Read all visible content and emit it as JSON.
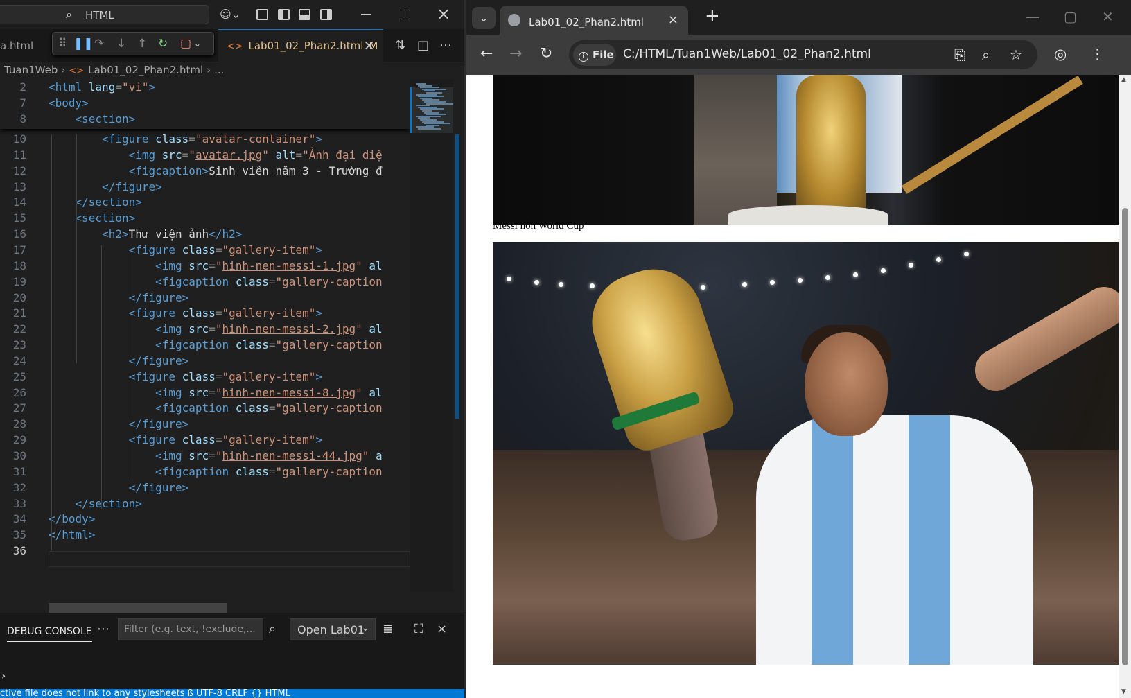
{
  "vscode": {
    "command_center": "HTML",
    "tab_prev": "a.html",
    "tab_active": {
      "label": "Lab01_02_Phan2.html",
      "modified": "M"
    },
    "breadcrumb": [
      "Tuan1Web",
      "Lab01_02_Phan2.html",
      "..."
    ],
    "sticky_lines": [
      {
        "n": "2",
        "code": [
          [
            "tg",
            "<html"
          ],
          [
            "at",
            " lang"
          ],
          [
            "pu",
            "="
          ],
          [
            "st",
            "\"vi\""
          ],
          [
            "tg",
            ">"
          ]
        ]
      },
      {
        "n": "7",
        "code": [
          [
            "tg",
            "<body>"
          ]
        ]
      },
      {
        "n": "8",
        "code": [
          [
            "tx",
            "    "
          ],
          [
            "tg",
            "<section>"
          ]
        ]
      }
    ],
    "lines": [
      {
        "n": "10",
        "code": [
          [
            "tx",
            "        "
          ],
          [
            "tg",
            "<figure"
          ],
          [
            "at",
            " class"
          ],
          [
            "pu",
            "="
          ],
          [
            "st",
            "\"avatar-container\""
          ],
          [
            "tg",
            ">"
          ]
        ]
      },
      {
        "n": "11",
        "code": [
          [
            "tx",
            "            "
          ],
          [
            "tg",
            "<img"
          ],
          [
            "at",
            " src"
          ],
          [
            "pu",
            "="
          ],
          [
            "st",
            "\""
          ],
          [
            "stu",
            "avatar.jpg"
          ],
          [
            "st",
            "\""
          ],
          [
            "at",
            " alt"
          ],
          [
            "pu",
            "="
          ],
          [
            "st",
            "\"Ảnh đại diệ"
          ]
        ]
      },
      {
        "n": "12",
        "code": [
          [
            "tx",
            "            "
          ],
          [
            "tg",
            "<figcaption>"
          ],
          [
            "tx",
            "Sinh viên năm 3 - Trường đ"
          ]
        ]
      },
      {
        "n": "13",
        "code": [
          [
            "tx",
            "        "
          ],
          [
            "tg",
            "</figure>"
          ]
        ]
      },
      {
        "n": "14",
        "code": [
          [
            "tx",
            "    "
          ],
          [
            "tg",
            "</section>"
          ]
        ]
      },
      {
        "n": "15",
        "code": [
          [
            "tx",
            "    "
          ],
          [
            "tg",
            "<section>"
          ]
        ]
      },
      {
        "n": "16",
        "code": [
          [
            "tx",
            "        "
          ],
          [
            "tg",
            "<h2>"
          ],
          [
            "tx",
            "Thư viện ảnh"
          ],
          [
            "tg",
            "</h2>"
          ]
        ]
      },
      {
        "n": "17",
        "code": [
          [
            "tx",
            "            "
          ],
          [
            "tg",
            "<figure"
          ],
          [
            "at",
            " class"
          ],
          [
            "pu",
            "="
          ],
          [
            "st",
            "\"gallery-item\""
          ],
          [
            "tg",
            ">"
          ]
        ]
      },
      {
        "n": "18",
        "code": [
          [
            "tx",
            "                "
          ],
          [
            "tg",
            "<img"
          ],
          [
            "at",
            " src"
          ],
          [
            "pu",
            "="
          ],
          [
            "st",
            "\""
          ],
          [
            "stu",
            "hinh-nen-messi-1.jpg"
          ],
          [
            "st",
            "\""
          ],
          [
            "at",
            " al"
          ]
        ]
      },
      {
        "n": "19",
        "code": [
          [
            "tx",
            "                "
          ],
          [
            "tg",
            "<figcaption"
          ],
          [
            "at",
            " class"
          ],
          [
            "pu",
            "="
          ],
          [
            "st",
            "\"gallery-caption"
          ]
        ]
      },
      {
        "n": "20",
        "code": [
          [
            "tx",
            "            "
          ],
          [
            "tg",
            "</figure>"
          ]
        ]
      },
      {
        "n": "21",
        "code": [
          [
            "tx",
            "            "
          ],
          [
            "tg",
            "<figure"
          ],
          [
            "at",
            " class"
          ],
          [
            "pu",
            "="
          ],
          [
            "st",
            "\"gallery-item\""
          ],
          [
            "tg",
            ">"
          ]
        ]
      },
      {
        "n": "22",
        "code": [
          [
            "tx",
            "                "
          ],
          [
            "tg",
            "<img"
          ],
          [
            "at",
            " src"
          ],
          [
            "pu",
            "="
          ],
          [
            "st",
            "\""
          ],
          [
            "stu",
            "hinh-nen-messi-2.jpg"
          ],
          [
            "st",
            "\""
          ],
          [
            "at",
            " al"
          ]
        ]
      },
      {
        "n": "23",
        "code": [
          [
            "tx",
            "                "
          ],
          [
            "tg",
            "<figcaption"
          ],
          [
            "at",
            " class"
          ],
          [
            "pu",
            "="
          ],
          [
            "st",
            "\"gallery-caption"
          ]
        ]
      },
      {
        "n": "24",
        "code": [
          [
            "tx",
            "            "
          ],
          [
            "tg",
            "</figure>"
          ]
        ]
      },
      {
        "n": "25",
        "code": [
          [
            "tx",
            "            "
          ],
          [
            "tg",
            "<figure"
          ],
          [
            "at",
            " class"
          ],
          [
            "pu",
            "="
          ],
          [
            "st",
            "\"gallery-item\""
          ],
          [
            "tg",
            ">"
          ]
        ]
      },
      {
        "n": "26",
        "code": [
          [
            "tx",
            "                "
          ],
          [
            "tg",
            "<img"
          ],
          [
            "at",
            " src"
          ],
          [
            "pu",
            "="
          ],
          [
            "st",
            "\""
          ],
          [
            "stu",
            "hinh-nen-messi-8.jpg"
          ],
          [
            "st",
            "\""
          ],
          [
            "at",
            " al"
          ]
        ]
      },
      {
        "n": "27",
        "code": [
          [
            "tx",
            "                "
          ],
          [
            "tg",
            "<figcaption"
          ],
          [
            "at",
            " class"
          ],
          [
            "pu",
            "="
          ],
          [
            "st",
            "\"gallery-caption"
          ]
        ]
      },
      {
        "n": "28",
        "code": [
          [
            "tx",
            "            "
          ],
          [
            "tg",
            "</figure>"
          ]
        ]
      },
      {
        "n": "29",
        "code": [
          [
            "tx",
            "            "
          ],
          [
            "tg",
            "<figure"
          ],
          [
            "at",
            " class"
          ],
          [
            "pu",
            "="
          ],
          [
            "st",
            "\"gallery-item\""
          ],
          [
            "tg",
            ">"
          ]
        ]
      },
      {
        "n": "30",
        "code": [
          [
            "tx",
            "                "
          ],
          [
            "tg",
            "<img"
          ],
          [
            "at",
            " src"
          ],
          [
            "pu",
            "="
          ],
          [
            "st",
            "\""
          ],
          [
            "stu",
            "hinh-nen-messi-44.jpg"
          ],
          [
            "st",
            "\""
          ],
          [
            "at",
            " a"
          ]
        ]
      },
      {
        "n": "31",
        "code": [
          [
            "tx",
            "                "
          ],
          [
            "tg",
            "<figcaption"
          ],
          [
            "at",
            " class"
          ],
          [
            "pu",
            "="
          ],
          [
            "st",
            "\"gallery-caption"
          ]
        ]
      },
      {
        "n": "32",
        "code": [
          [
            "tx",
            "            "
          ],
          [
            "tg",
            "</figure>"
          ]
        ]
      },
      {
        "n": "33",
        "code": [
          [
            "tx",
            "    "
          ],
          [
            "tg",
            "</section>"
          ]
        ]
      },
      {
        "n": "34",
        "code": [
          [
            "tg",
            "</body>"
          ]
        ]
      },
      {
        "n": "35",
        "code": [
          [
            "tg",
            "</html>"
          ]
        ]
      },
      {
        "n": "36",
        "code": []
      }
    ],
    "panel": {
      "tab": "DEBUG CONSOLE",
      "filter_placeholder": "Filter (e.g. text, !exclude,...",
      "select_value": "Open Lab01"
    },
    "status": "ctive file does not link to any stylesheets      ß     UTF-8   CRLF   {} HTML"
  },
  "browser": {
    "tab_title": "Lab01_02_Phan2.html",
    "chip": "File",
    "url": "C:/HTML/Tuan1Web/Lab01_02_Phan2.html",
    "caption1": "Messi hôn World Cup"
  }
}
